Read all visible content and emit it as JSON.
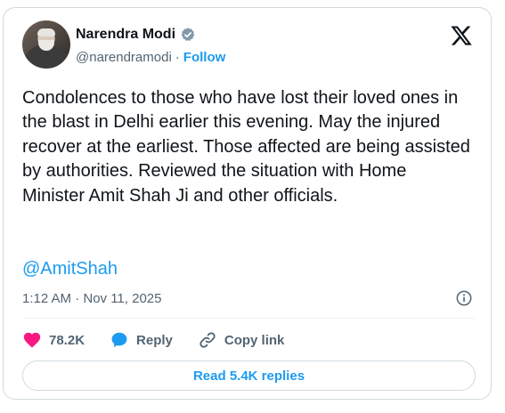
{
  "author": {
    "name": "Narendra Modi",
    "handle": "@narendramodi",
    "separator": "·",
    "follow_label": "Follow"
  },
  "tweet": {
    "text": "Condolences to those who have lost their loved ones in the blast in Delhi earlier this evening. May the injured recover at the earliest. Those affected are being assisted by authorities. Reviewed the situation with Home Minister Amit Shah Ji and other officials.",
    "mention": "@AmitShah",
    "timestamp": "1:12 AM · Nov 11, 2025"
  },
  "actions": {
    "likes": "78.2K",
    "reply_label": "Reply",
    "copy_link_label": "Copy link"
  },
  "replies_button": "Read 5.4K replies",
  "icons": {
    "verified": "verified-badge-icon",
    "platform": "x-logo-icon",
    "info": "info-icon",
    "like": "heart-icon",
    "reply": "speech-bubble-icon",
    "copy": "link-icon"
  },
  "colors": {
    "accent": "#1d9bf0",
    "like": "#f91880",
    "muted": "#536471",
    "text": "#0f1419"
  }
}
